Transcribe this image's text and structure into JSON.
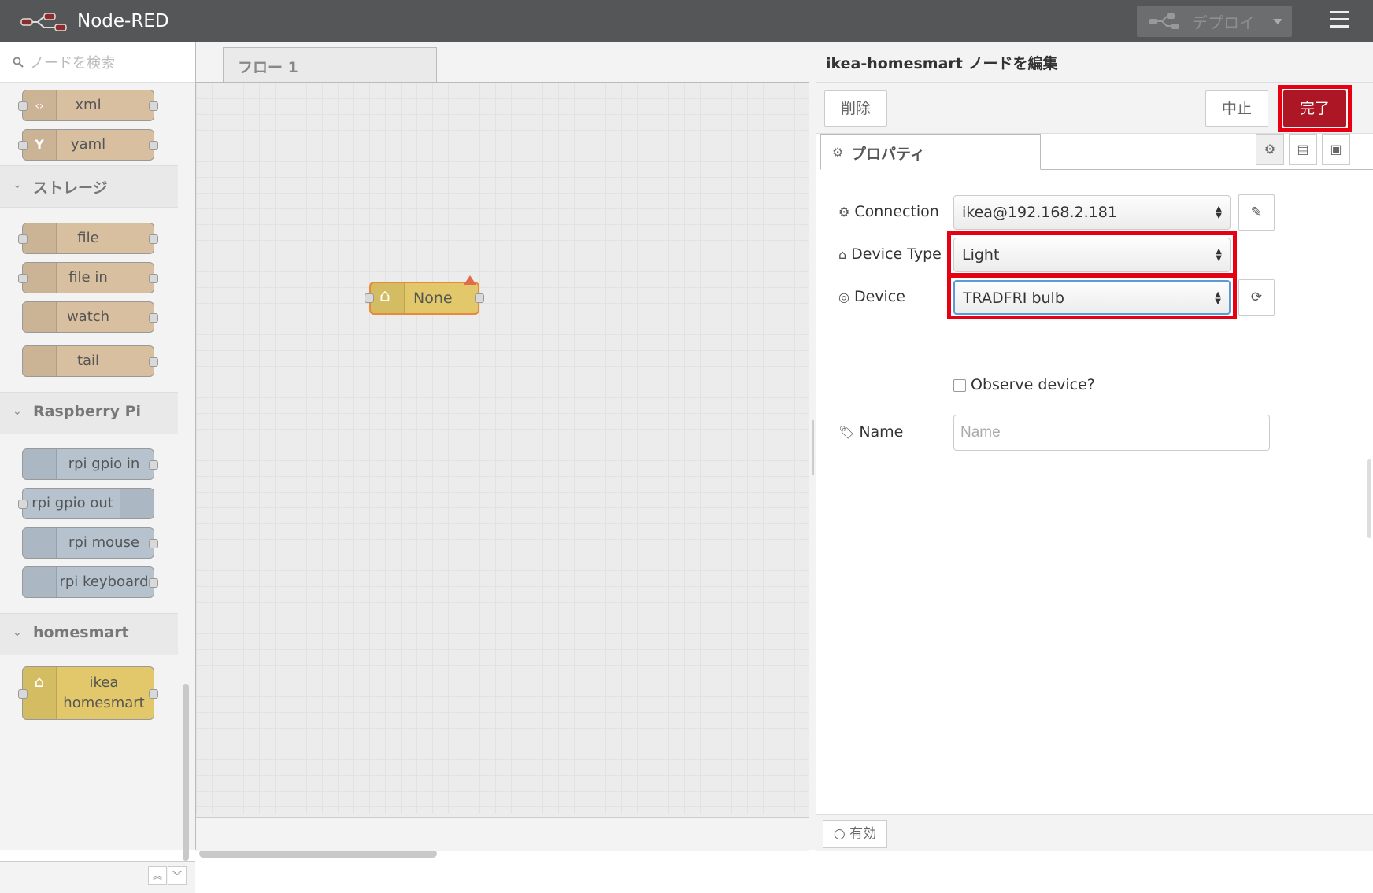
{
  "header": {
    "title": "Node-RED",
    "deploy_label": "デプロイ"
  },
  "palette": {
    "search_placeholder": "ノードを検索",
    "nodes_top": [
      {
        "label": "xml"
      },
      {
        "label": "yaml"
      }
    ],
    "categories": [
      {
        "title": "ストレージ",
        "nodes": [
          "file",
          "file in",
          "watch",
          "tail"
        ]
      },
      {
        "title": "Raspberry Pi",
        "nodes": [
          "rpi gpio in",
          "rpi gpio out",
          "rpi mouse",
          "rpi keyboard"
        ]
      },
      {
        "title": "homesmart",
        "nodes": [
          "ikea homesmart"
        ]
      }
    ],
    "homesmart_node_line1": "ikea",
    "homesmart_node_line2": "homesmart"
  },
  "workspace": {
    "tab_label": "フロー 1",
    "flow_node_label": "None"
  },
  "editor": {
    "title": "ikea-homesmart ノードを編集",
    "delete_label": "削除",
    "cancel_label": "中止",
    "done_label": "完了",
    "properties_tab": "プロパティ",
    "connection_label": "Connection",
    "connection_value": "ikea@192.168.2.181",
    "device_type_label": "Device Type",
    "device_type_value": "Light",
    "device_label": "Device",
    "device_value": "TRADFRI bulb",
    "observe_label": "Observe device?",
    "name_label": "Name",
    "name_placeholder": "Name",
    "enable_label": "有効"
  },
  "colors": {
    "header_bg": "#555657",
    "done_button": "#ad1625",
    "highlight": "#e60012",
    "storage_node": "#d8bfa0",
    "homesmart_node": "#e2c86a",
    "rpi_node": "#b6c3cf"
  }
}
